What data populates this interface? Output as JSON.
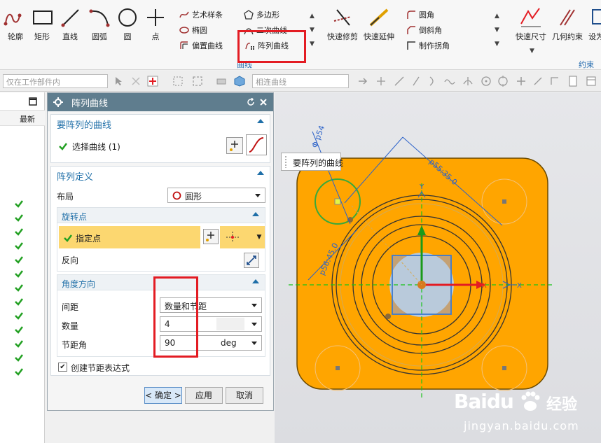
{
  "ribbon": {
    "big_buttons": [
      {
        "label": "轮廓",
        "icon": "profile-icon"
      },
      {
        "label": "矩形",
        "icon": "rectangle-icon"
      },
      {
        "label": "直线",
        "icon": "line-icon"
      },
      {
        "label": "圆弧",
        "icon": "arc-icon"
      },
      {
        "label": "圆",
        "icon": "circle-icon"
      },
      {
        "label": "点",
        "icon": "point-icon"
      }
    ],
    "curve_small": {
      "art_spline": "艺术样条",
      "polygon": "多边形",
      "ellipse": "椭圆",
      "conic": "二次曲线",
      "offset_curve": "偏置曲线",
      "pattern_curve": "阵列曲线"
    },
    "curve_group_label": "曲线",
    "quick_trim": "快速修剪",
    "quick_extend": "快速延伸",
    "corner_small": {
      "fillet": "圆角",
      "chamfer": "倒斜角",
      "make_corner": "制作拐角"
    },
    "quick_dimension": "快速尺寸",
    "geometric_constraints": "几何约束",
    "set_as": "设为",
    "constraint_group_label": "约束",
    "accent_color": "#e31c23"
  },
  "toolbar": {
    "filter_placeholder": "仅在工作部件内",
    "curve_rule": "相连曲线"
  },
  "navigator": {
    "column_label": "最新",
    "check_count": 13
  },
  "dialog": {
    "title": "阵列曲线",
    "section_curves": {
      "title": "要阵列的曲线",
      "select_label": "选择曲线 (1)"
    },
    "section_definition": {
      "title": "阵列定义",
      "layout_label": "布局",
      "layout_value": "圆形",
      "rotation_point": {
        "title": "旋转点",
        "specify_point": "指定点",
        "reverse": "反向"
      },
      "angle_direction": {
        "title": "角度方向",
        "spacing_label": "间距",
        "spacing_value": "数量和节距",
        "count_label": "数量",
        "count_value": "4",
        "pitch_label": "节距角",
        "pitch_value": "90",
        "pitch_unit": "deg"
      },
      "create_expression": "创建节距表达式"
    },
    "buttons": {
      "ok": "< 确定 >",
      "apply": "应用",
      "cancel": "取消"
    }
  },
  "viewport": {
    "tooltip": "要阵列的曲线",
    "dimensions": {
      "d1": "Φ p54",
      "d2": "p55:35.0",
      "d3": "p56:45.0"
    },
    "part_color": "#ffa500",
    "axis_labels": {
      "x": "X",
      "y": "Y"
    }
  },
  "watermark": {
    "brand": "Baidu",
    "cn": "经验",
    "url": "jingyan.baidu.com"
  }
}
